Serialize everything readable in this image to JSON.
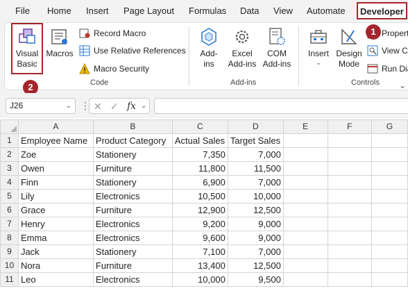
{
  "tabs": [
    "File",
    "Home",
    "Insert",
    "Page Layout",
    "Formulas",
    "Data",
    "View",
    "Automate",
    "Developer"
  ],
  "active_tab": "Developer",
  "ribbon": {
    "code": {
      "visual_basic": [
        "Visual",
        "Basic"
      ],
      "macros": "Macros",
      "record_macro": "Record Macro",
      "use_relative": "Use Relative References",
      "macro_security": "Macro Security",
      "group_label": "Code"
    },
    "addins": {
      "addins": [
        "Add-",
        "ins"
      ],
      "excel_addins": [
        "Excel",
        "Add-ins"
      ],
      "com_addins": [
        "COM",
        "Add-ins"
      ],
      "group_label": "Add-ins"
    },
    "controls": {
      "insert": "Insert",
      "design_mode": [
        "Design",
        "Mode"
      ],
      "properties": "Properties",
      "view_code": "View Code",
      "run_dialog": "Run Dialog",
      "group_label": "Controls"
    },
    "badges": [
      "1",
      "2"
    ]
  },
  "formula_bar": {
    "name_box": "J26",
    "formula": ""
  },
  "grid": {
    "columns": [
      "A",
      "B",
      "C",
      "D",
      "E",
      "F",
      "G"
    ],
    "headers": [
      "Employee Name",
      "Product Category",
      "Actual Sales",
      "Target Sales"
    ],
    "rows": [
      [
        "Zoe",
        "Stationery",
        "7,350",
        "7,000"
      ],
      [
        "Owen",
        "Furniture",
        "11,800",
        "11,500"
      ],
      [
        "Finn",
        "Stationery",
        "6,900",
        "7,000"
      ],
      [
        "Lily",
        "Electronics",
        "10,500",
        "10,000"
      ],
      [
        "Grace",
        "Furniture",
        "12,900",
        "12,500"
      ],
      [
        "Henry",
        "Electronics",
        "9,200",
        "9,000"
      ],
      [
        "Emma",
        "Electronics",
        "9,600",
        "9,000"
      ],
      [
        "Jack",
        "Stationery",
        "7,100",
        "7,000"
      ],
      [
        "Nora",
        "Furniture",
        "13,400",
        "12,500"
      ],
      [
        "Leo",
        "Electronics",
        "10,000",
        "9,500"
      ]
    ]
  },
  "colors": {
    "accent": "#a4262c",
    "ribbon_bg": "#f3f3f3",
    "header_bg": "#f0f0f0"
  }
}
